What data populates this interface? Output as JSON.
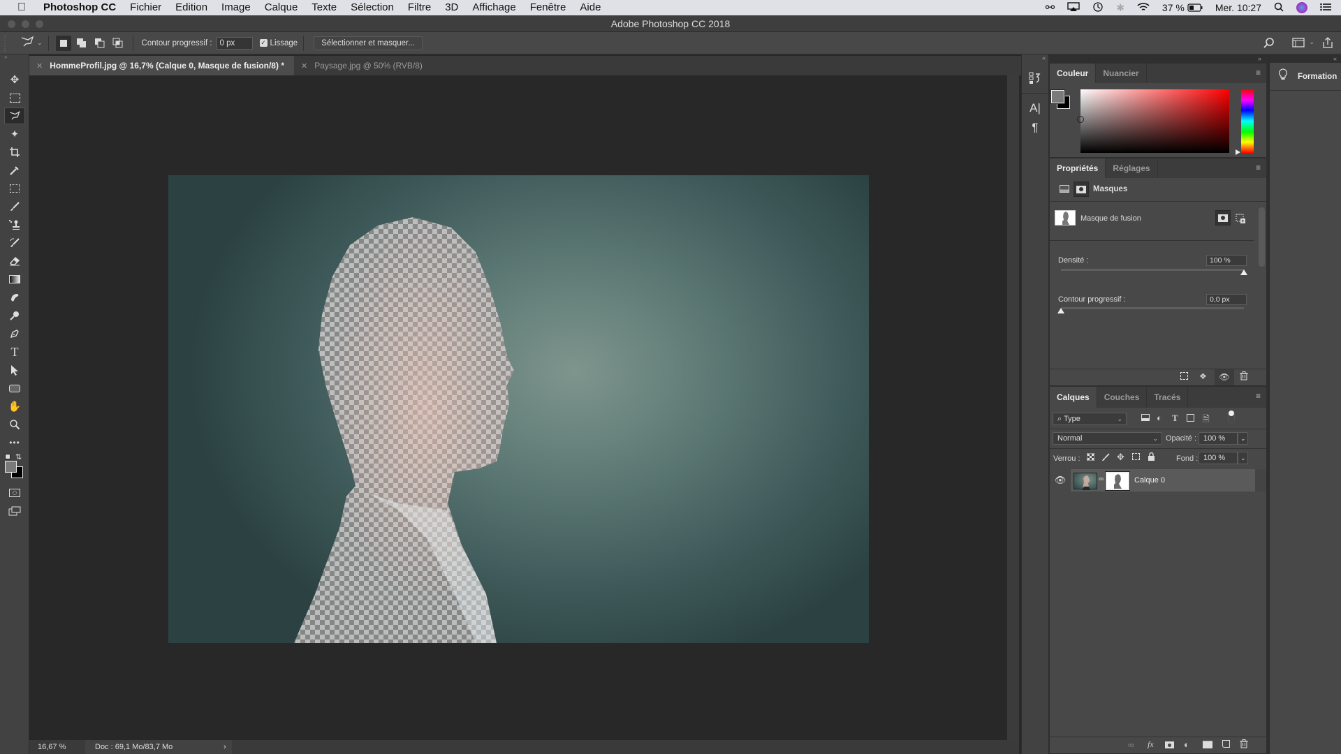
{
  "macos_menubar": {
    "apple_icon": "apple-logo",
    "app_name": "Photoshop CC",
    "menus": [
      "Fichier",
      "Edition",
      "Image",
      "Calque",
      "Texte",
      "Sélection",
      "Filtre",
      "3D",
      "Affichage",
      "Fenêtre",
      "Aide"
    ],
    "status": {
      "icons": [
        "creative-cloud-icon",
        "airplay-icon",
        "time-machine-icon",
        "bluetooth-icon",
        "wifi-icon"
      ],
      "battery_percent": "37 %",
      "clock": "Mer. 10:27",
      "right_icons": [
        "spotlight-icon",
        "siri-icon",
        "notification-center-icon"
      ]
    }
  },
  "window": {
    "title": "Adobe Photoshop CC 2018"
  },
  "options_bar": {
    "tool_icon": "polygonal-lasso-icon",
    "selection_modes": [
      "new-selection",
      "add-to-selection",
      "subtract-from-selection",
      "intersect-selection"
    ],
    "active_mode": "new-selection",
    "feather_label": "Contour progressif :",
    "feather_value": "0 px",
    "antialias_label": "Lissage",
    "antialias_checked": true,
    "select_mask_button": "Sélectionner et masquer...",
    "right_icons": [
      "search-icon",
      "workspace-icon",
      "share-icon"
    ]
  },
  "toolbox": {
    "tools": [
      "move",
      "rectangular-marquee",
      "polygonal-lasso",
      "magic-wand",
      "crop",
      "eyedropper",
      "frame",
      "brush",
      "clone-stamp",
      "history-brush",
      "eraser",
      "gradient",
      "smudge",
      "dodge",
      "pen",
      "type",
      "path-selection",
      "rectangle",
      "hand",
      "zoom",
      "more-tools"
    ],
    "active_tool": "polygonal-lasso",
    "foreground_color": "#7a7a7a",
    "background_color": "#000000"
  },
  "document_tabs": [
    {
      "label": "HommeProfil.jpg @ 16,7% (Calque 0, Masque de fusion/8) *",
      "active": true
    },
    {
      "label": "Paysage.jpg @ 50% (RVB/8)",
      "active": false
    }
  ],
  "status_bar": {
    "zoom": "16,67 %",
    "doc_info": "Doc : 69,1 Mo/83,7 Mo",
    "arrow": "›"
  },
  "color_panel": {
    "tabs": [
      "Couleur",
      "Nuancier"
    ],
    "active_tab": "Couleur",
    "foreground": "#7a7a7a",
    "background": "#000000",
    "hue_color": "#ff0000"
  },
  "properties_panel": {
    "tabs": [
      "Propriétés",
      "Réglages"
    ],
    "active_tab": "Propriétés",
    "section_title": "Masques",
    "mask_label": "Masque de fusion",
    "density_label": "Densité :",
    "density_value": "100 %",
    "density_fraction": 1.0,
    "feather_label": "Contour progressif :",
    "feather_value": "0,0 px",
    "feather_fraction": 0.0
  },
  "layers_panel": {
    "tabs": [
      "Calques",
      "Couches",
      "Tracés"
    ],
    "active_tab": "Calques",
    "filter_label": "Type",
    "blend_mode": "Normal",
    "opacity_label": "Opacité :",
    "opacity_value": "100 %",
    "lock_label": "Verrou :",
    "fill_label": "Fond :",
    "fill_value": "100 %",
    "layers": [
      {
        "name": "Calque 0",
        "visible": true,
        "has_mask": true,
        "selected": true
      }
    ],
    "bottom_icons": [
      "link-layers-icon",
      "fx-icon",
      "add-mask-icon",
      "adjustment-layer-icon",
      "group-icon",
      "new-layer-icon",
      "trash-icon"
    ]
  },
  "learn_panel": {
    "label": "Formation"
  }
}
